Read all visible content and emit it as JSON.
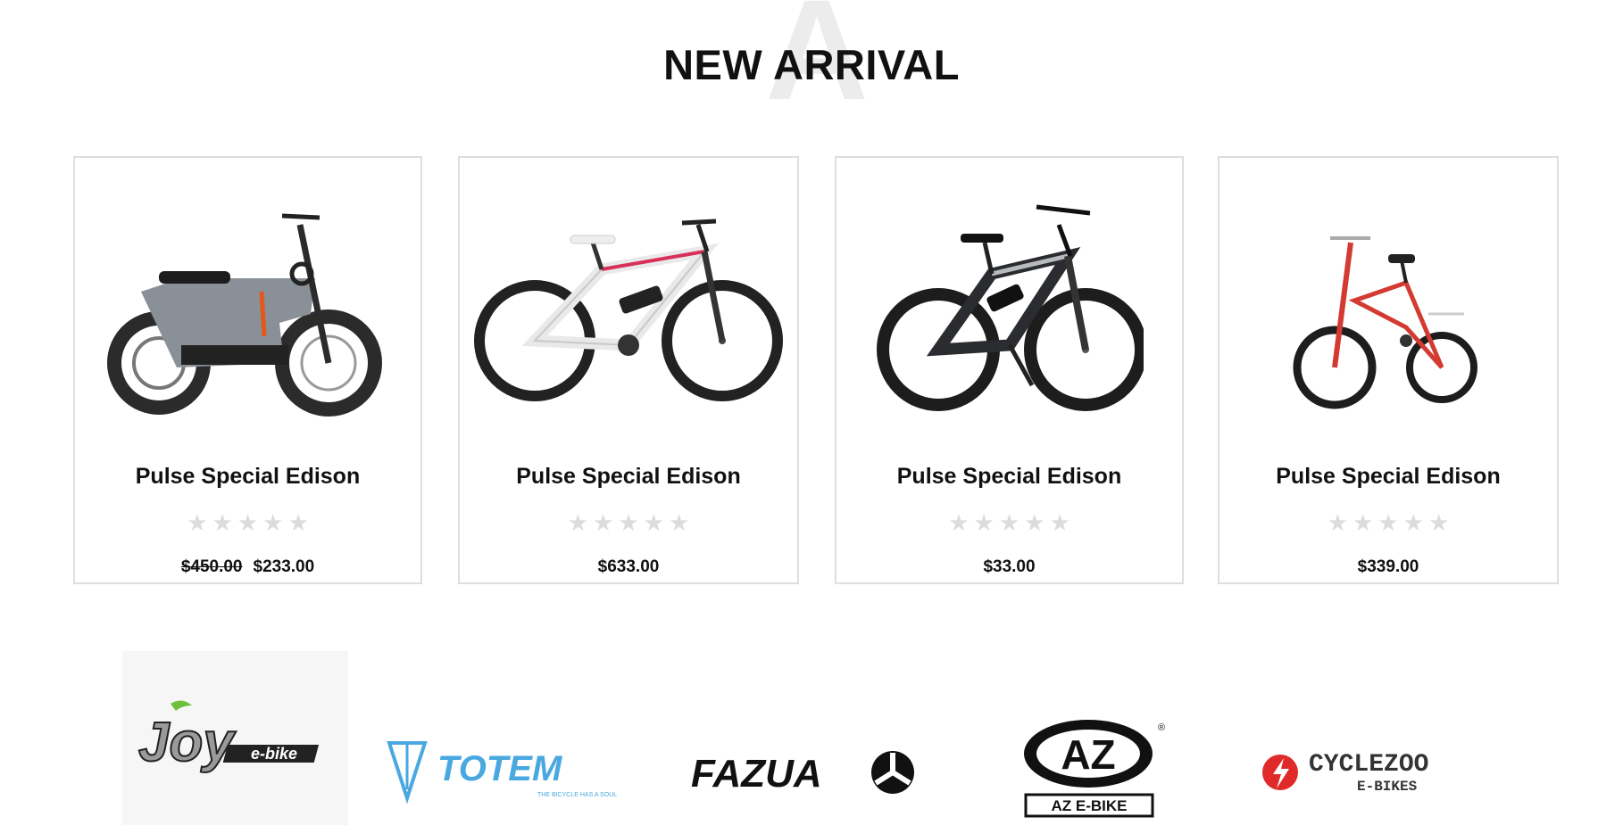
{
  "section": {
    "title": "NEW ARRIVAL",
    "watermark_letter": "A"
  },
  "products": [
    {
      "name": "Pulse Special Edison",
      "rating": 0,
      "max_rating": 5,
      "old_price": "$450.00",
      "price": "$233.00",
      "image": "electric-scooter-bike",
      "frame_color": "#8a9097"
    },
    {
      "name": "Pulse Special Edison",
      "rating": 0,
      "max_rating": 5,
      "old_price": "",
      "price": "$633.00",
      "image": "white-e-mountain-bike",
      "frame_color": "#e9e9ea"
    },
    {
      "name": "Pulse Special Edison",
      "rating": 0,
      "max_rating": 5,
      "old_price": "",
      "price": "$33.00",
      "image": "black-e-mountain-bike",
      "frame_color": "#2a2c30"
    },
    {
      "name": "Pulse Special Edison",
      "rating": 0,
      "max_rating": 5,
      "old_price": "",
      "price": "$339.00",
      "image": "red-folding-bike",
      "frame_color": "#d23a32"
    }
  ],
  "brands": [
    {
      "label": "Joy",
      "sub": "e-bike",
      "logo": "joy-ebike-logo"
    },
    {
      "label": "TOTEM",
      "tagline": "THE BICYCLE HAS A SOUL",
      "logo": "totem-logo",
      "color": "#4aa8e0"
    },
    {
      "label": "FAZUA",
      "logo": "fazua-logo"
    },
    {
      "label": "AZ",
      "sub": "AZ E-BIKE",
      "mark": "®",
      "logo": "az-ebike-logo"
    },
    {
      "label": "CYCLEZOO",
      "sub": "E-BIKES",
      "logo": "cyclezoo-logo",
      "color": "#e02a2a"
    }
  ],
  "colors": {
    "star_empty": "#dcdcdc",
    "card_border": "#dedede",
    "watermark": "#ececec"
  }
}
